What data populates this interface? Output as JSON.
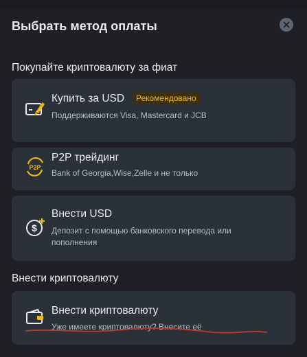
{
  "header": {
    "title": "Выбрать метод оплаты",
    "close_icon": "close-icon"
  },
  "fiat_section": {
    "title": "Покупайте криптовалюту за фиат",
    "options": [
      {
        "label": "Купить за USD",
        "badge": "Рекомендовано",
        "description": "Поддерживаются Visa, Mastercard и JCB",
        "icon": "card-rocket-icon"
      },
      {
        "label": "P2P трейдинг",
        "description": "Bank of Georgia,Wise,Zelle и не только",
        "icon": "p2p-icon",
        "icon_text": "P2P"
      },
      {
        "label": "Внести USD",
        "description_line1": "Депозит с помощью банковского перевода или",
        "description_line2": "пополнения",
        "icon": "dollar-plus-icon"
      }
    ]
  },
  "crypto_section": {
    "title": "Внести криптовалюту",
    "options": [
      {
        "label": "Внести криптовалюту",
        "description": "Уже имеете криптовалюту? Внесите её",
        "icon": "wallet-icon"
      }
    ]
  },
  "colors": {
    "background": "#1e2026",
    "card": "#2b3139",
    "accent": "#f0b90b",
    "text": "#eaecef",
    "secondary_text": "#b7bdc6",
    "annotation_stroke": "#c0392b"
  }
}
